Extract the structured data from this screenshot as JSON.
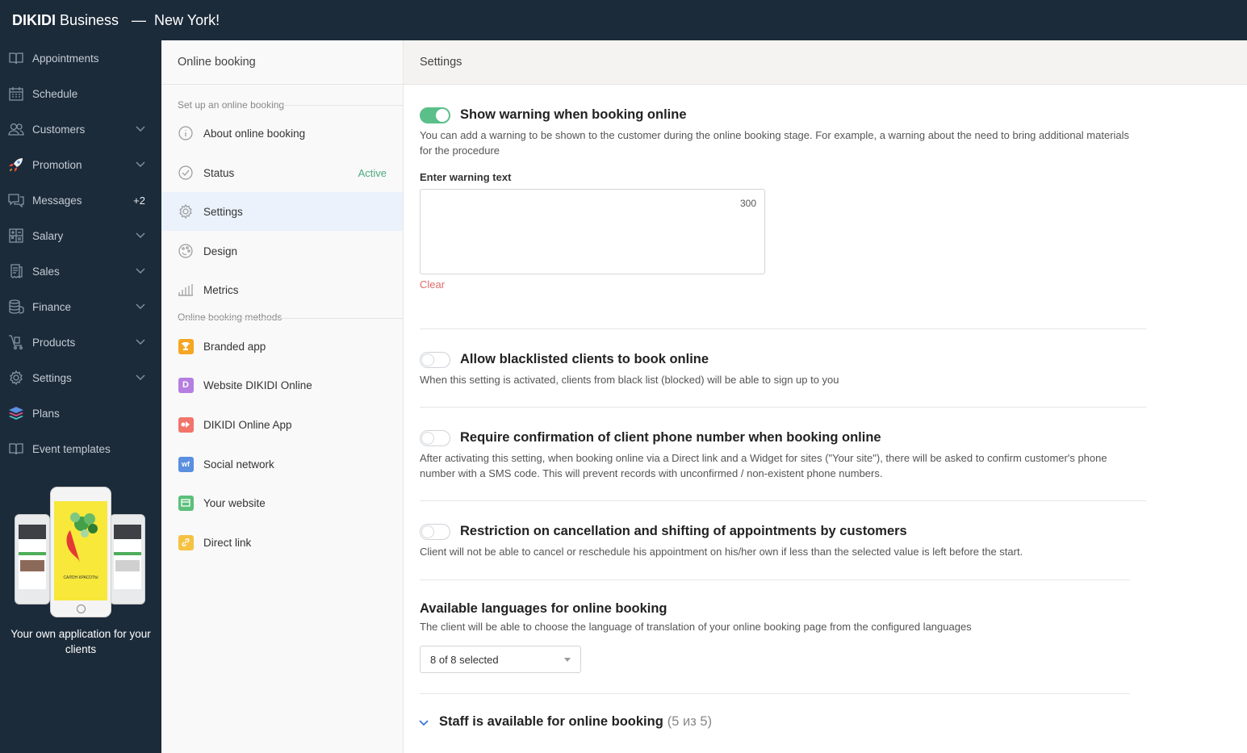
{
  "topbar": {
    "brand_bold": "DIKIDI",
    "brand_light": "Business",
    "separator": "—",
    "location": "New York!"
  },
  "sidebar": {
    "items": [
      {
        "label": "Appointments",
        "icon": "book-icon"
      },
      {
        "label": "Schedule",
        "icon": "calendar-icon"
      },
      {
        "label": "Customers",
        "icon": "users-icon",
        "has_chevron": true
      },
      {
        "label": "Promotion",
        "icon": "rocket-icon",
        "has_chevron": true
      },
      {
        "label": "Messages",
        "icon": "chat-icon",
        "badge": "+2"
      },
      {
        "label": "Salary",
        "icon": "calculator-icon",
        "has_chevron": true
      },
      {
        "label": "Sales",
        "icon": "receipt-icon",
        "has_chevron": true
      },
      {
        "label": "Finance",
        "icon": "coins-icon",
        "has_chevron": true
      },
      {
        "label": "Products",
        "icon": "cart-icon",
        "has_chevron": true
      },
      {
        "label": "Settings",
        "icon": "gear-icon",
        "has_chevron": true
      },
      {
        "label": "Plans",
        "icon": "layers-icon"
      },
      {
        "label": "Event templates",
        "icon": "book-icon"
      }
    ],
    "promo_text": "Your own application for your clients",
    "promo_phone_text": "САЛОН КРАСОТЫ"
  },
  "middle": {
    "header": "Online booking",
    "group1_title": "Set up an online booking",
    "group1": [
      {
        "label": "About online booking",
        "icon": "info-icon"
      },
      {
        "label": "Status",
        "icon": "check-circle-icon",
        "value": "Active"
      },
      {
        "label": "Settings",
        "icon": "gear-icon",
        "active": true
      },
      {
        "label": "Design",
        "icon": "palette-icon"
      },
      {
        "label": "Metrics",
        "icon": "bar-chart-icon"
      }
    ],
    "group2_title": "Online booking methods",
    "group2": [
      {
        "label": "Branded app",
        "icon": "trophy-icon",
        "color": "#f5a623"
      },
      {
        "label": "Website DIKIDI Online",
        "icon": "d-letter-icon",
        "color": "#b57ee0"
      },
      {
        "label": "DIKIDI Online App",
        "icon": "app-icon",
        "color": "#f2746b"
      },
      {
        "label": "Social network",
        "icon": "wf-icon",
        "color": "#5b8fe0"
      },
      {
        "label": "Your website",
        "icon": "browser-icon",
        "color": "#5bc07a"
      },
      {
        "label": "Direct link",
        "icon": "link-icon",
        "color": "#f5c242"
      }
    ]
  },
  "content": {
    "header": "Settings",
    "sections": [
      {
        "title": "Show warning when booking online",
        "enabled": true,
        "description": "You can add a warning to be shown to the customer during the online booking stage. For example, a warning about the need to bring additional materials for the procedure"
      },
      {
        "title": "Allow blacklisted clients to book online",
        "enabled": false,
        "description": "When this setting is activated, clients from black list (blocked) will be able to sign up to you"
      },
      {
        "title": "Require confirmation of client phone number when booking online",
        "enabled": false,
        "description": "After activating this setting, when booking online via a Direct link and a Widget for sites (\"Your site\"), there will be asked to confirm customer's phone number with a SMS code. This will prevent records with unconfirmed / non-existent phone numbers."
      },
      {
        "title": "Restriction on cancellation and shifting of appointments by customers",
        "enabled": false,
        "description": "Client will not be able to cancel or reschedule his appointment on his/her own if less than the selected value is left before the start."
      }
    ],
    "warning": {
      "label": "Enter warning text",
      "value": "",
      "counter": "300",
      "clear_label": "Clear"
    },
    "languages": {
      "title": "Available languages for online booking",
      "description": "The client will be able to choose the language of translation of your online booking page from the configured languages",
      "selected": "8 of 8 selected"
    },
    "staff": {
      "title": "Staff is available for online booking",
      "count": "(5 из 5)"
    }
  }
}
